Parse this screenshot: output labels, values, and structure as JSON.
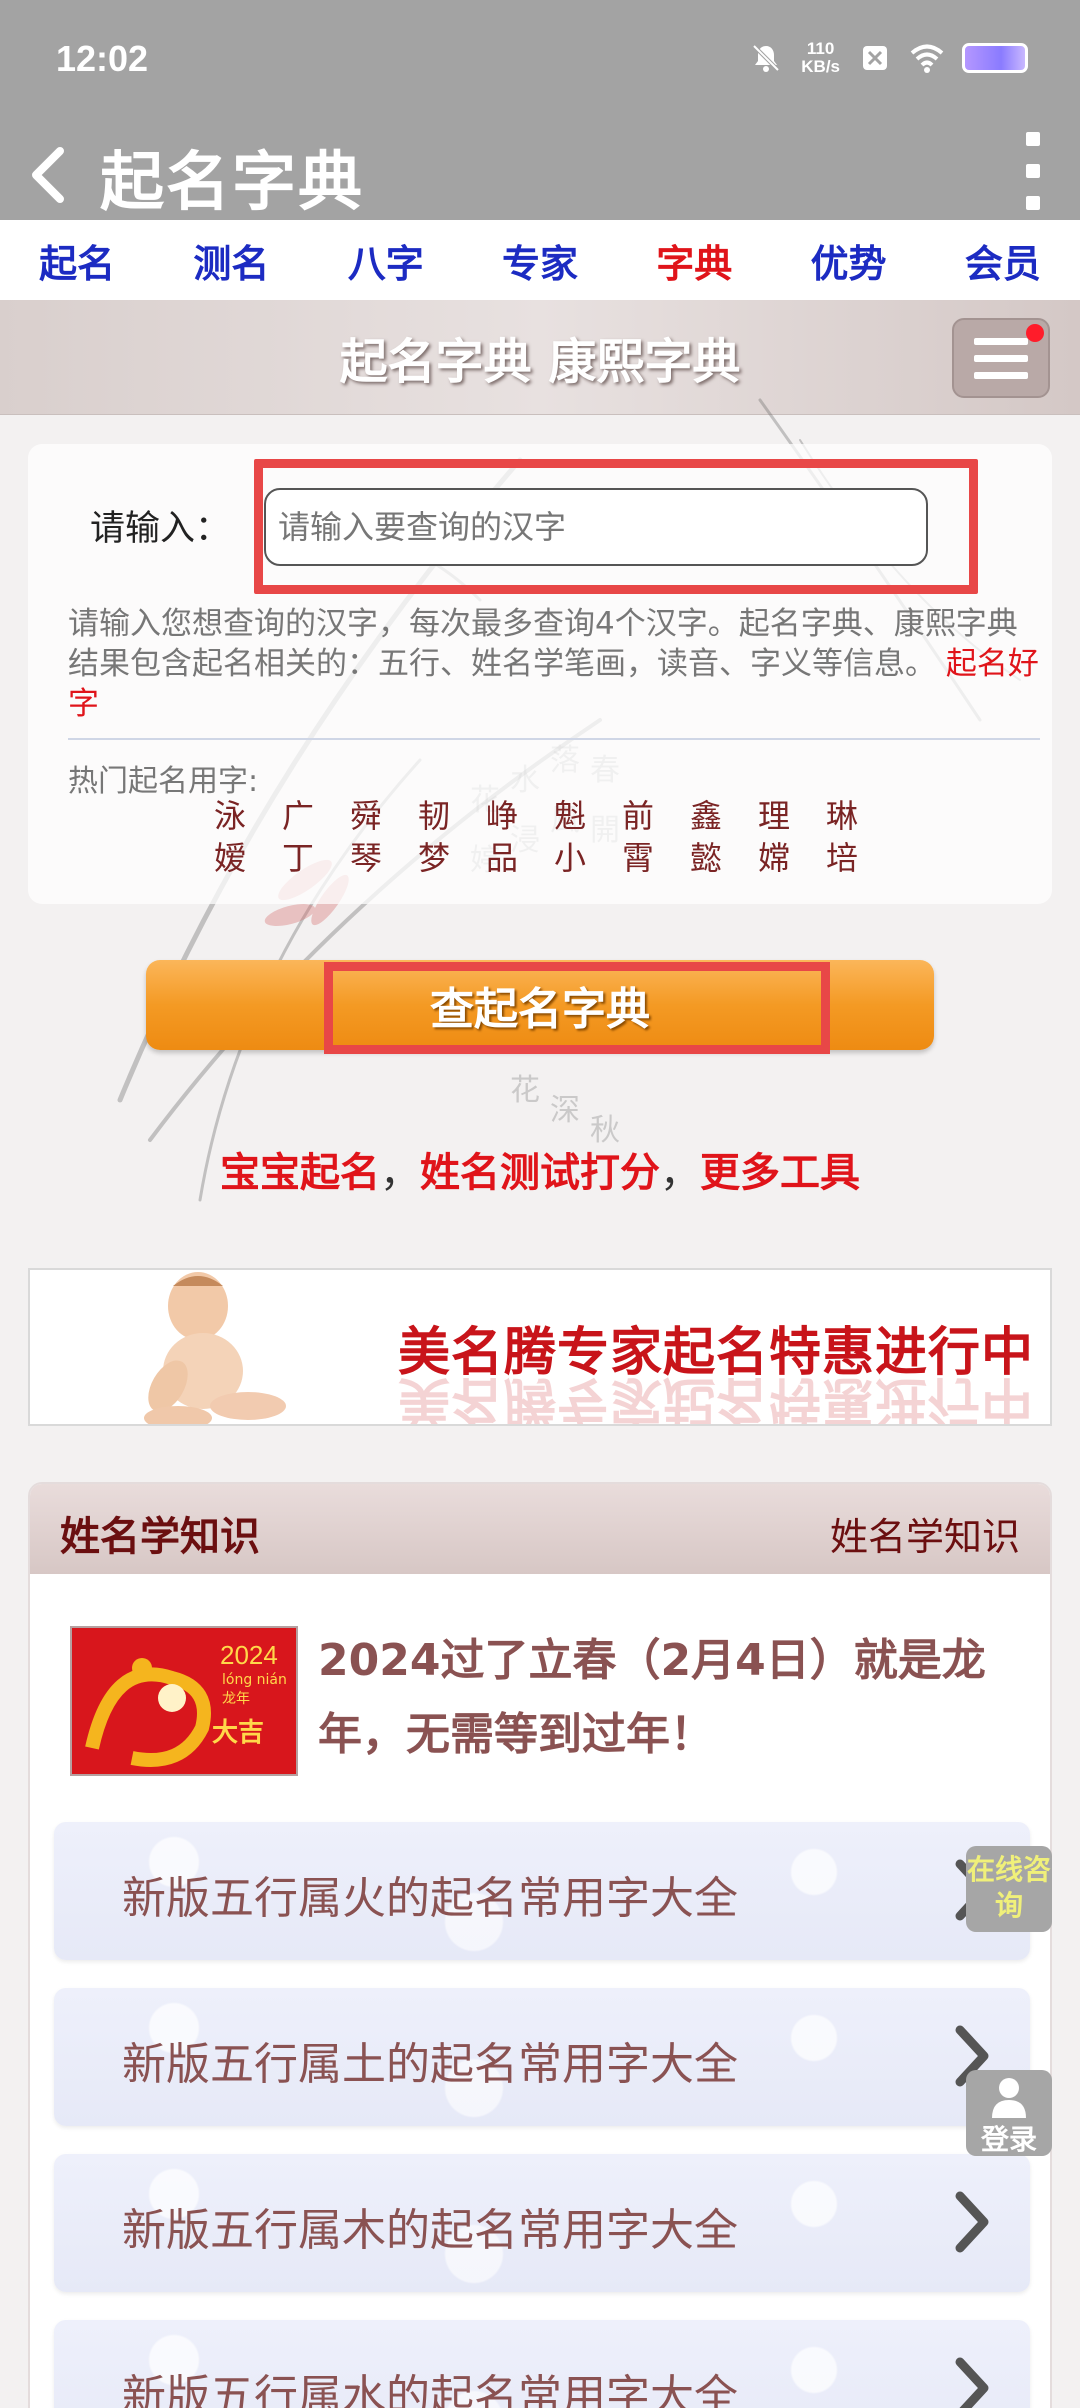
{
  "status_bar": {
    "time": "12:02",
    "net_speed_value": "110",
    "net_speed_unit": "KB/s",
    "icons": [
      "bell-muted-icon",
      "close-box-icon",
      "wifi-icon",
      "battery-icon"
    ]
  },
  "app_bar": {
    "title": "起名字典",
    "back_icon": "chevron-left-icon",
    "more_icon": "more-vertical-icon"
  },
  "nav": {
    "items": [
      {
        "label": "起名",
        "active": false
      },
      {
        "label": "测名",
        "active": false
      },
      {
        "label": "八字",
        "active": false
      },
      {
        "label": "专家",
        "active": false
      },
      {
        "label": "字典",
        "active": true
      },
      {
        "label": "优势",
        "active": false
      },
      {
        "label": "会员",
        "active": false
      }
    ],
    "active_color": "#e0141a",
    "color": "#1c2bc2"
  },
  "header": {
    "title": "起名字典 康熙字典",
    "menu_icon": "hamburger-menu-icon"
  },
  "search": {
    "label": "请输入：",
    "placeholder": "请输入要查询的汉字",
    "value": "",
    "description": "请输入您想查询的汉字，每次最多查询4个汉字。起名字典、康熙字典结果包含起名相关的：五行、姓名学笔画，读音、字义等信息。",
    "description_link": "起名好字",
    "hot_label": "热门起名用字:",
    "hot_chars": [
      "泳",
      "广",
      "舜",
      "韧",
      "峥",
      "魁",
      "前",
      "鑫",
      "理",
      "琳",
      "嫒",
      "丁",
      "琴",
      "梦",
      "品",
      "小",
      "霄",
      "懿",
      "嫦",
      "培"
    ],
    "button_label": "查起名字典"
  },
  "links": {
    "items": [
      "宝宝起名",
      "姓名测试打分",
      "更多工具"
    ],
    "separator": "，"
  },
  "banner": {
    "text": "美名腾专家起名特惠进行中"
  },
  "knowledge": {
    "title": "姓名学知识",
    "more_link": "姓名学知识",
    "featured": {
      "title": "2024过了立春（2月4日）就是龙年，无需等到过年！",
      "thumb_year": "2024",
      "thumb_small": "lóng nián 龙年",
      "thumb_big": "大吉"
    },
    "items": [
      "新版五行属火的起名常用字大全",
      "新版五行属土的起名常用字大全",
      "新版五行属木的起名常用字大全",
      "新版五行属水的起名常用字大全"
    ]
  },
  "floating": {
    "consult": "在线咨询",
    "login": "登录"
  }
}
